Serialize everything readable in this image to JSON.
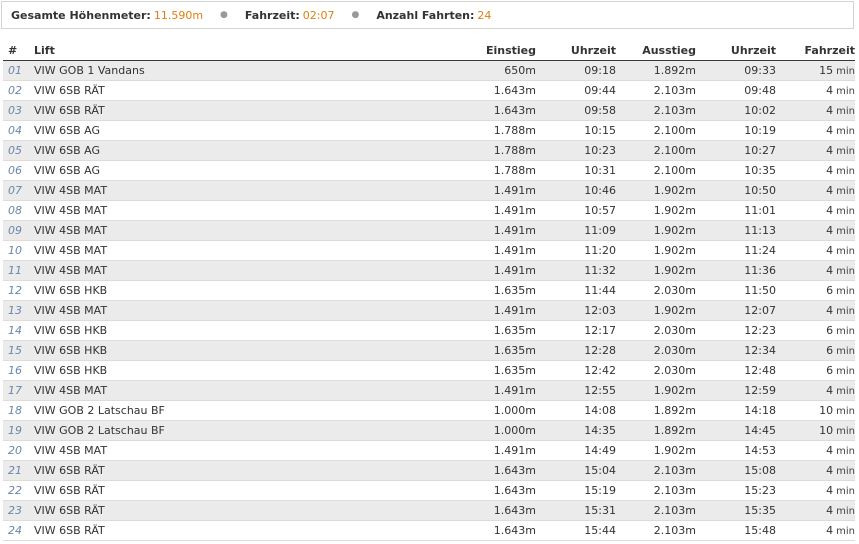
{
  "summary": {
    "elevation_label": "Gesamte Höhenmeter:",
    "elevation_value": "11.590m",
    "time_label": "Fahrzeit:",
    "time_value": "02:07",
    "rides_label": "Anzahl Fahrten:",
    "rides_value": "24",
    "separator": "●"
  },
  "table": {
    "headers": {
      "num": "#",
      "lift": "Lift",
      "entry": "Einstieg",
      "entry_time": "Uhrzeit",
      "exit": "Ausstieg",
      "exit_time": "Uhrzeit",
      "duration": "Fahrzeit"
    },
    "duration_unit": "min",
    "rows": [
      {
        "num": "01",
        "lift": "VIW GOB 1 Vandans",
        "entry": "650m",
        "entry_time": "09:18",
        "exit": "1.892m",
        "exit_time": "09:33",
        "duration": "15"
      },
      {
        "num": "02",
        "lift": "VIW 6SB RÄT",
        "entry": "1.643m",
        "entry_time": "09:44",
        "exit": "2.103m",
        "exit_time": "09:48",
        "duration": "4"
      },
      {
        "num": "03",
        "lift": "VIW 6SB RÄT",
        "entry": "1.643m",
        "entry_time": "09:58",
        "exit": "2.103m",
        "exit_time": "10:02",
        "duration": "4"
      },
      {
        "num": "04",
        "lift": "VIW 6SB AG",
        "entry": "1.788m",
        "entry_time": "10:15",
        "exit": "2.100m",
        "exit_time": "10:19",
        "duration": "4"
      },
      {
        "num": "05",
        "lift": "VIW 6SB AG",
        "entry": "1.788m",
        "entry_time": "10:23",
        "exit": "2.100m",
        "exit_time": "10:27",
        "duration": "4"
      },
      {
        "num": "06",
        "lift": "VIW 6SB AG",
        "entry": "1.788m",
        "entry_time": "10:31",
        "exit": "2.100m",
        "exit_time": "10:35",
        "duration": "4"
      },
      {
        "num": "07",
        "lift": "VIW 4SB MAT",
        "entry": "1.491m",
        "entry_time": "10:46",
        "exit": "1.902m",
        "exit_time": "10:50",
        "duration": "4"
      },
      {
        "num": "08",
        "lift": "VIW 4SB MAT",
        "entry": "1.491m",
        "entry_time": "10:57",
        "exit": "1.902m",
        "exit_time": "11:01",
        "duration": "4"
      },
      {
        "num": "09",
        "lift": "VIW 4SB MAT",
        "entry": "1.491m",
        "entry_time": "11:09",
        "exit": "1.902m",
        "exit_time": "11:13",
        "duration": "4"
      },
      {
        "num": "10",
        "lift": "VIW 4SB MAT",
        "entry": "1.491m",
        "entry_time": "11:20",
        "exit": "1.902m",
        "exit_time": "11:24",
        "duration": "4"
      },
      {
        "num": "11",
        "lift": "VIW 4SB MAT",
        "entry": "1.491m",
        "entry_time": "11:32",
        "exit": "1.902m",
        "exit_time": "11:36",
        "duration": "4"
      },
      {
        "num": "12",
        "lift": "VIW 6SB HKB",
        "entry": "1.635m",
        "entry_time": "11:44",
        "exit": "2.030m",
        "exit_time": "11:50",
        "duration": "6"
      },
      {
        "num": "13",
        "lift": "VIW 4SB MAT",
        "entry": "1.491m",
        "entry_time": "12:03",
        "exit": "1.902m",
        "exit_time": "12:07",
        "duration": "4"
      },
      {
        "num": "14",
        "lift": "VIW 6SB HKB",
        "entry": "1.635m",
        "entry_time": "12:17",
        "exit": "2.030m",
        "exit_time": "12:23",
        "duration": "6"
      },
      {
        "num": "15",
        "lift": "VIW 6SB HKB",
        "entry": "1.635m",
        "entry_time": "12:28",
        "exit": "2.030m",
        "exit_time": "12:34",
        "duration": "6"
      },
      {
        "num": "16",
        "lift": "VIW 6SB HKB",
        "entry": "1.635m",
        "entry_time": "12:42",
        "exit": "2.030m",
        "exit_time": "12:48",
        "duration": "6"
      },
      {
        "num": "17",
        "lift": "VIW 4SB MAT",
        "entry": "1.491m",
        "entry_time": "12:55",
        "exit": "1.902m",
        "exit_time": "12:59",
        "duration": "4"
      },
      {
        "num": "18",
        "lift": "VIW GOB 2 Latschau BF",
        "entry": "1.000m",
        "entry_time": "14:08",
        "exit": "1.892m",
        "exit_time": "14:18",
        "duration": "10"
      },
      {
        "num": "19",
        "lift": "VIW GOB 2 Latschau BF",
        "entry": "1.000m",
        "entry_time": "14:35",
        "exit": "1.892m",
        "exit_time": "14:45",
        "duration": "10"
      },
      {
        "num": "20",
        "lift": "VIW 4SB MAT",
        "entry": "1.491m",
        "entry_time": "14:49",
        "exit": "1.902m",
        "exit_time": "14:53",
        "duration": "4"
      },
      {
        "num": "21",
        "lift": "VIW 6SB RÄT",
        "entry": "1.643m",
        "entry_time": "15:04",
        "exit": "2.103m",
        "exit_time": "15:08",
        "duration": "4"
      },
      {
        "num": "22",
        "lift": "VIW 6SB RÄT",
        "entry": "1.643m",
        "entry_time": "15:19",
        "exit": "2.103m",
        "exit_time": "15:23",
        "duration": "4"
      },
      {
        "num": "23",
        "lift": "VIW 6SB RÄT",
        "entry": "1.643m",
        "entry_time": "15:31",
        "exit": "2.103m",
        "exit_time": "15:35",
        "duration": "4"
      },
      {
        "num": "24",
        "lift": "VIW 6SB RÄT",
        "entry": "1.643m",
        "entry_time": "15:44",
        "exit": "2.103m",
        "exit_time": "15:48",
        "duration": "4"
      }
    ]
  }
}
